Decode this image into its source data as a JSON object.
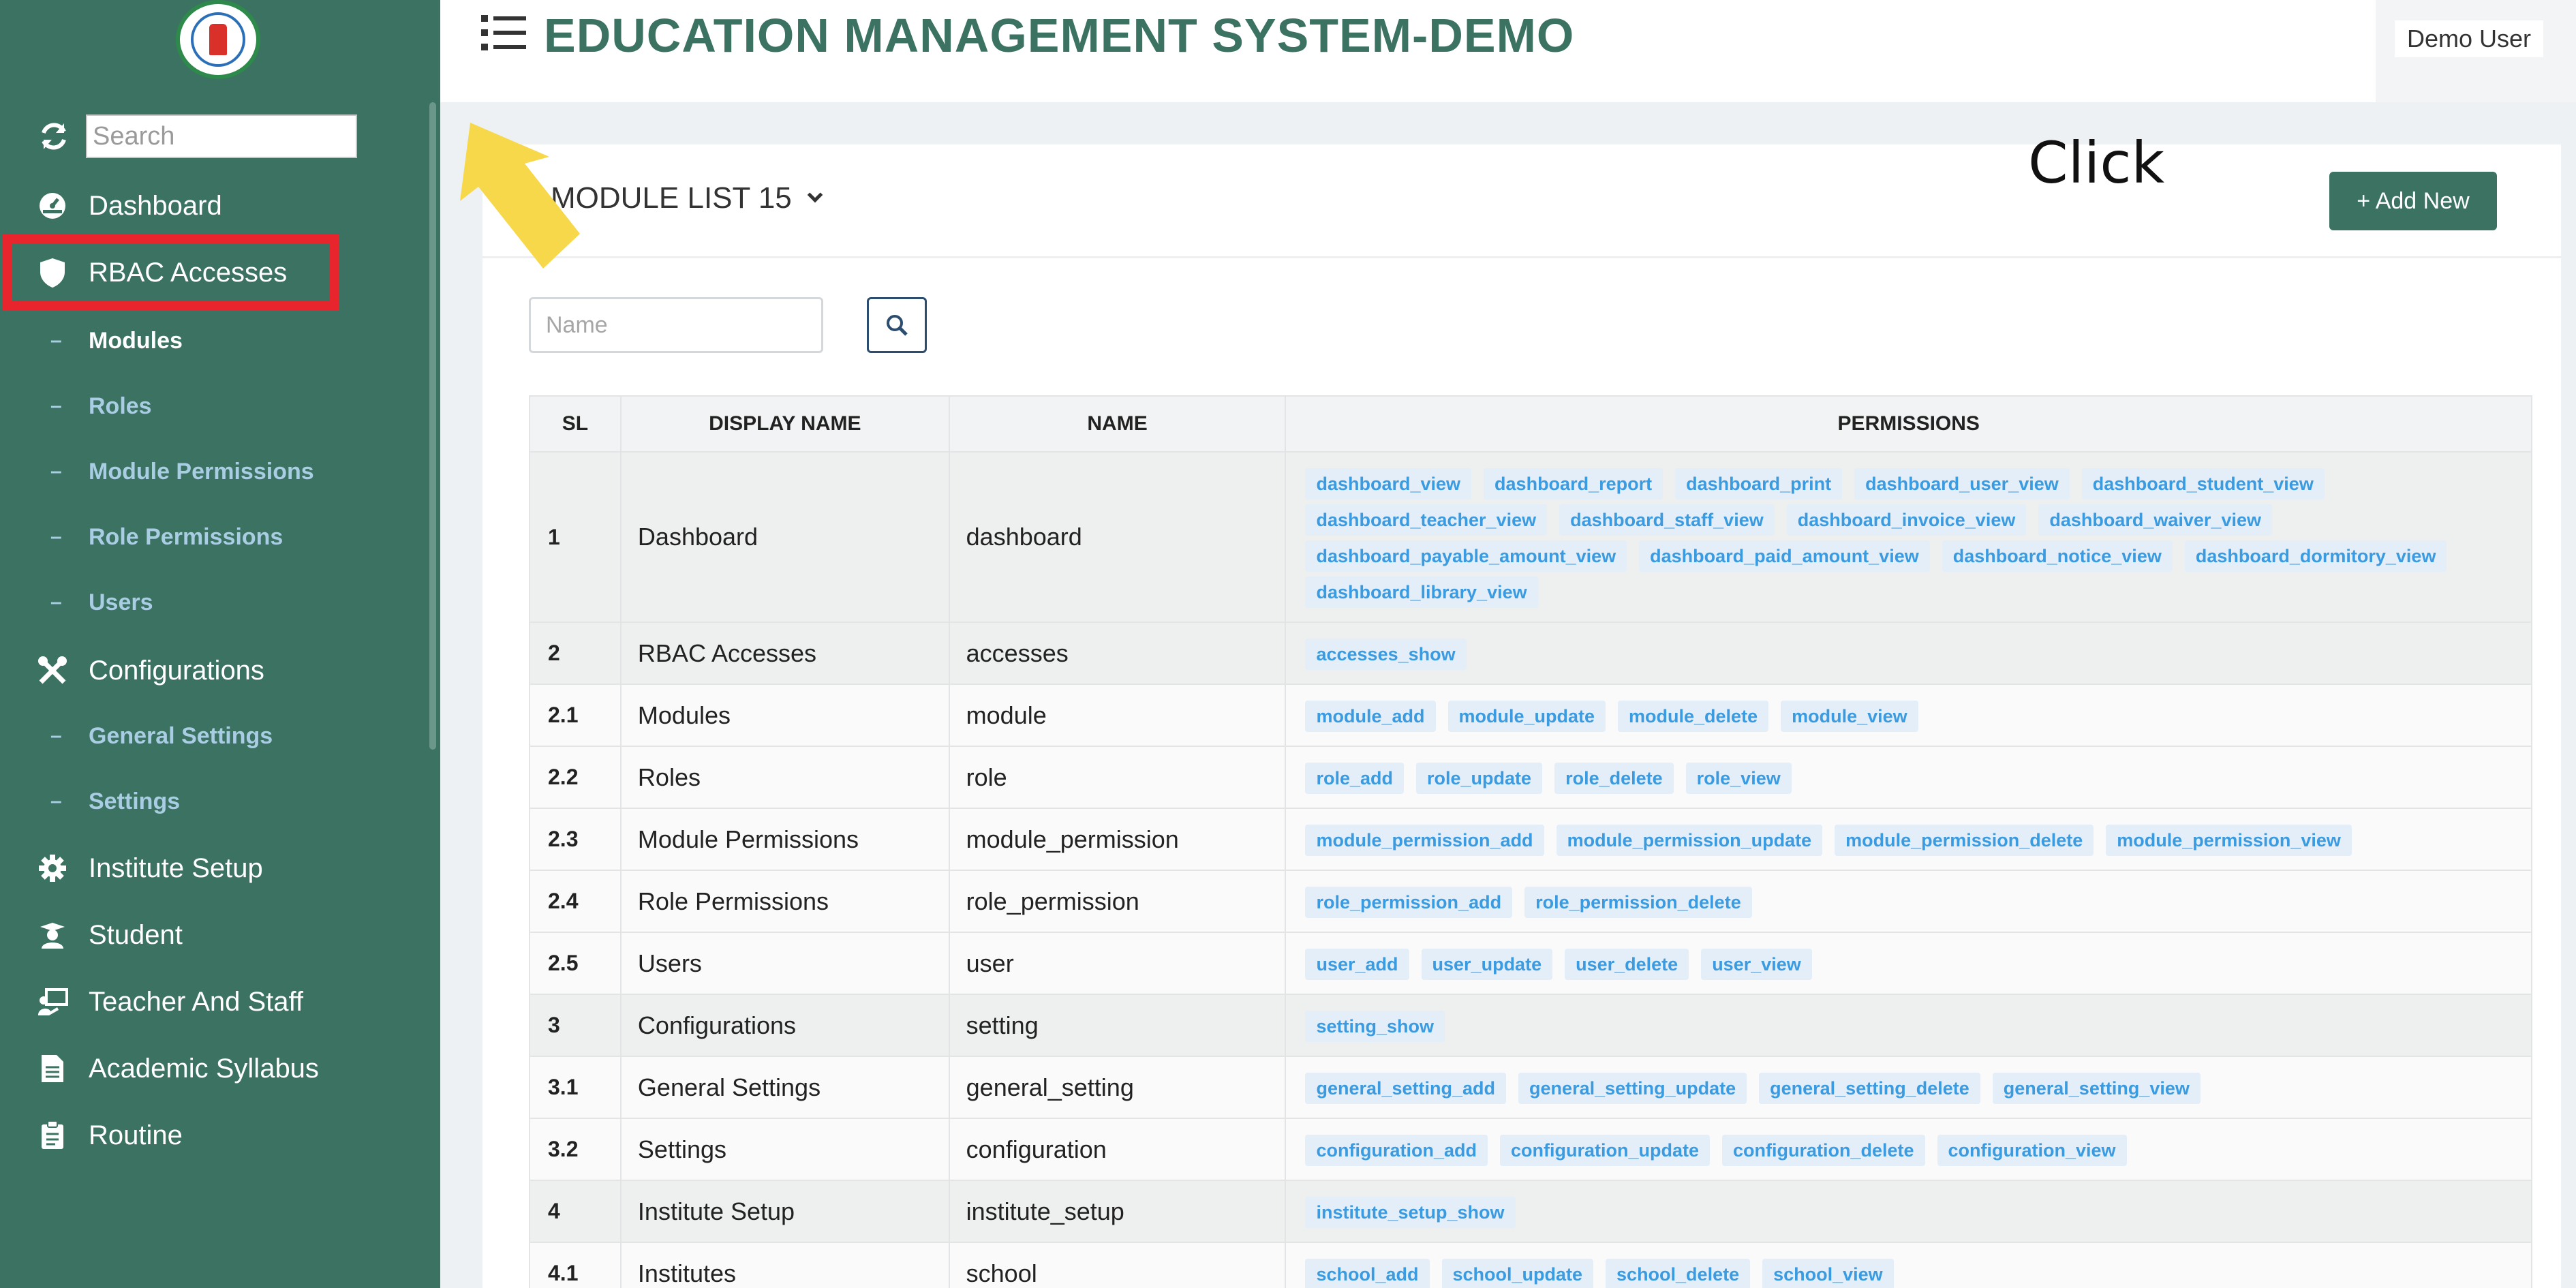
{
  "sidebar": {
    "search_placeholder": "Search",
    "items": [
      {
        "label": "Dashboard",
        "icon": "dashboard-gauge-icon"
      },
      {
        "label": "RBAC Accesses",
        "icon": "shield-icon"
      },
      {
        "label": "Configurations",
        "icon": "tools-icon"
      },
      {
        "label": "Institute Setup",
        "icon": "gear-icon"
      },
      {
        "label": "Student",
        "icon": "graduate-icon"
      },
      {
        "label": "Teacher And Staff",
        "icon": "teacher-board-icon"
      },
      {
        "label": "Academic Syllabus",
        "icon": "document-icon"
      },
      {
        "label": "Routine",
        "icon": "clipboard-icon"
      }
    ],
    "rbac_sub": [
      "Modules",
      "Roles",
      "Module Permissions",
      "Role Permissions",
      "Users"
    ],
    "config_sub": [
      "General Settings",
      "Settings"
    ],
    "active_sub": "Modules"
  },
  "header": {
    "title": "EDUCATION MANAGEMENT SYSTEM-DEMO",
    "user": "Demo User"
  },
  "main": {
    "module_list_label": "MODULE LIST 15",
    "add_new_label": "+ Add New",
    "annotation_text": "Click",
    "name_placeholder": "Name",
    "columns": [
      "SL",
      "DISPLAY NAME",
      "NAME",
      "PERMISSIONS"
    ],
    "rows": [
      {
        "sl": "1",
        "display": "Dashboard",
        "name": "dashboard",
        "type": "head",
        "perms": [
          "dashboard_view",
          "dashboard_report",
          "dashboard_print",
          "dashboard_user_view",
          "dashboard_student_view",
          "dashboard_teacher_view",
          "dashboard_staff_view",
          "dashboard_invoice_view",
          "dashboard_waiver_view",
          "dashboard_payable_amount_view",
          "dashboard_paid_amount_view",
          "dashboard_notice_view",
          "dashboard_dormitory_view",
          "dashboard_library_view"
        ]
      },
      {
        "sl": "2",
        "display": "RBAC Accesses",
        "name": "accesses",
        "type": "head",
        "perms": [
          "accesses_show"
        ]
      },
      {
        "sl": "2.1",
        "display": "Modules",
        "name": "module",
        "type": "sub",
        "perms": [
          "module_add",
          "module_update",
          "module_delete",
          "module_view"
        ]
      },
      {
        "sl": "2.2",
        "display": "Roles",
        "name": "role",
        "type": "sub",
        "perms": [
          "role_add",
          "role_update",
          "role_delete",
          "role_view"
        ]
      },
      {
        "sl": "2.3",
        "display": "Module Permissions",
        "name": "module_permission",
        "type": "sub",
        "perms": [
          "module_permission_add",
          "module_permission_update",
          "module_permission_delete",
          "module_permission_view"
        ]
      },
      {
        "sl": "2.4",
        "display": "Role Permissions",
        "name": "role_permission",
        "type": "sub",
        "perms": [
          "role_permission_add",
          "role_permission_delete"
        ]
      },
      {
        "sl": "2.5",
        "display": "Users",
        "name": "user",
        "type": "sub",
        "perms": [
          "user_add",
          "user_update",
          "user_delete",
          "user_view"
        ]
      },
      {
        "sl": "3",
        "display": "Configurations",
        "name": "setting",
        "type": "head",
        "perms": [
          "setting_show"
        ]
      },
      {
        "sl": "3.1",
        "display": "General Settings",
        "name": "general_setting",
        "type": "sub",
        "perms": [
          "general_setting_add",
          "general_setting_update",
          "general_setting_delete",
          "general_setting_view"
        ]
      },
      {
        "sl": "3.2",
        "display": "Settings",
        "name": "configuration",
        "type": "sub",
        "perms": [
          "configuration_add",
          "configuration_update",
          "configuration_delete",
          "configuration_view"
        ]
      },
      {
        "sl": "4",
        "display": "Institute Setup",
        "name": "institute_setup",
        "type": "head",
        "perms": [
          "institute_setup_show"
        ]
      },
      {
        "sl": "4.1",
        "display": "Institutes",
        "name": "school",
        "type": "sub",
        "perms": [
          "school_add",
          "school_update",
          "school_delete",
          "school_view"
        ]
      }
    ]
  },
  "colors": {
    "sidebar": "#3b7262",
    "accent": "#3b7262",
    "tag_text": "#3a9be0",
    "tag_bg": "#e3eef9",
    "highlight_box": "#e8242c",
    "arrow": "#f7d84a"
  }
}
